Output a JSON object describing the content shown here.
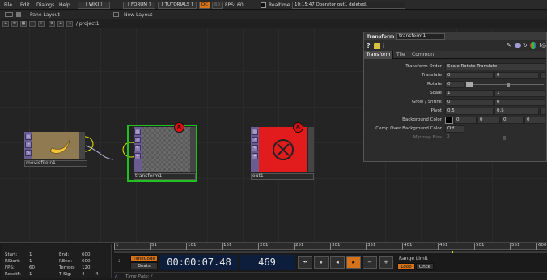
{
  "menu": {
    "file": "File",
    "edit": "Edit",
    "dialogs": "Dialogs",
    "help": "Help",
    "wiki": "[ WIKI ]",
    "forum": "[ FORUM ]",
    "tutorials": "[ TUTORIALS ]",
    "oc": "OC",
    "fps_label": "FPS:",
    "fps_value": "60",
    "perf": "60",
    "realtime": "Realtime",
    "status": "10:15:47 Operator out1 deleted."
  },
  "layout": {
    "pane_layout": "Pane Layout",
    "new_layout": "New Layout"
  },
  "path_bar": {
    "path": "/ project1"
  },
  "nodes": [
    {
      "name": "moviefilein1",
      "error": false
    },
    {
      "name": "transform1",
      "error": true,
      "selected": true
    },
    {
      "name": "out1",
      "error": true
    }
  ],
  "params": {
    "type": "Transform",
    "op_name": "transform1",
    "tabs": [
      "Transform",
      "Tile",
      "Common"
    ],
    "rows": [
      {
        "label": "Transform Order",
        "values": [
          "Scale Rotate Translate"
        ]
      },
      {
        "label": "Translate",
        "values": [
          "0",
          "0"
        ]
      },
      {
        "label": "Rotate",
        "values": [
          "0"
        ]
      },
      {
        "label": "Scale",
        "values": [
          "1",
          "1"
        ]
      },
      {
        "label": "Grow / Shrink",
        "values": [
          "0",
          "0"
        ]
      },
      {
        "label": "Pivot",
        "values": [
          "0.5",
          "0.5"
        ]
      },
      {
        "label": "Background Color",
        "values": [
          "0",
          "0",
          "0",
          "0"
        ]
      },
      {
        "label": "Comp Over Background Color",
        "values": [
          "Off"
        ]
      },
      {
        "label": "Mipmap Bias",
        "values": [
          "0"
        ]
      }
    ],
    "colors": {
      "background_swatch": "#000000"
    }
  },
  "timeline": {
    "ticks": [
      "1",
      "51",
      "101",
      "151",
      "201",
      "251",
      "301",
      "351",
      "401",
      "451",
      "501",
      "551",
      "600"
    ],
    "stats": {
      "start_l": "Start:",
      "start_v": "1",
      "end_l": "End:",
      "end_v": "600",
      "rstart_l": "RStart:",
      "rstart_v": "1",
      "rend_l": "REnd:",
      "rend_v": "600",
      "fps_l": "FPS:",
      "fps_v": "60",
      "tempo_l": "Tempo:",
      "tempo_v": "120",
      "resetf_l": "ResetF:",
      "resetf_v": "1",
      "tsig_l": "T Sig:",
      "tsig_a": "4",
      "tsig_b": "4"
    },
    "timecode_btn": "TimeCode",
    "beats_btn": "Beats",
    "timecode": "00:00:07.48",
    "frame": "469",
    "range_limit": "Range Limit",
    "loop": "Loop",
    "once": "Once",
    "time_path": "Time Path: /"
  }
}
